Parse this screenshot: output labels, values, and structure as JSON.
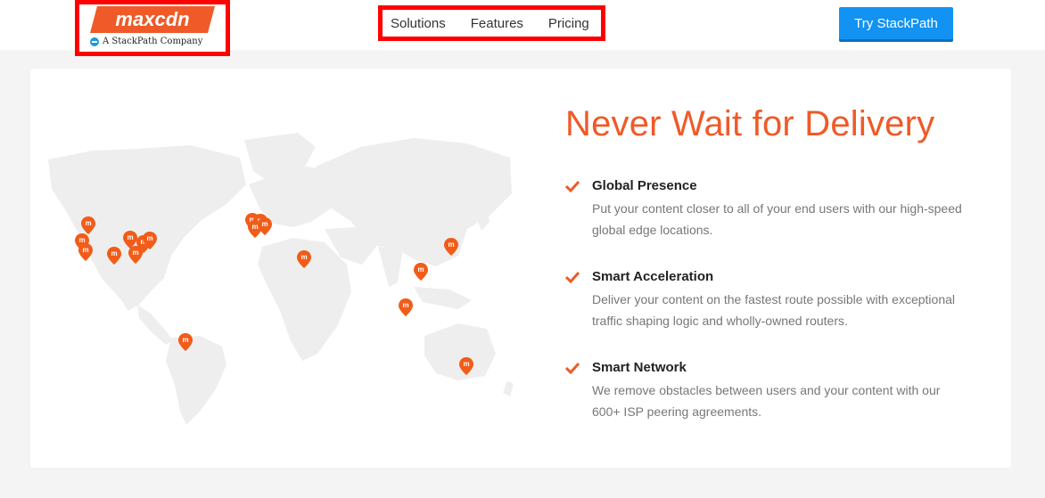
{
  "header": {
    "logo_text": "maxcdn",
    "logo_subtitle": "A StackPath Company",
    "nav": [
      {
        "label": "Solutions"
      },
      {
        "label": "Features"
      },
      {
        "label": "Pricing"
      }
    ],
    "cta_label": "Try StackPath"
  },
  "hero": {
    "headline": "Never Wait for Delivery",
    "features": [
      {
        "title": "Global Presence",
        "description": "Put your content closer to all of your end users with our high-speed global edge locations."
      },
      {
        "title": "Smart Acceleration",
        "description": "Deliver your content on the fastest route possible with exceptional traffic shaping logic and wholly-owned routers."
      },
      {
        "title": "Smart Network",
        "description": "We remove obstacles between users and your content with our 600+ ISP peering agreements."
      }
    ]
  },
  "colors": {
    "accent": "#ef5a28",
    "cta": "#1292f2",
    "highlight_border": "#ff0000",
    "map_land": "#eeeeee"
  },
  "icons": {
    "check": "check-icon",
    "map_pin": "map-pin-icon",
    "stackpath": "stackpath-icon"
  }
}
